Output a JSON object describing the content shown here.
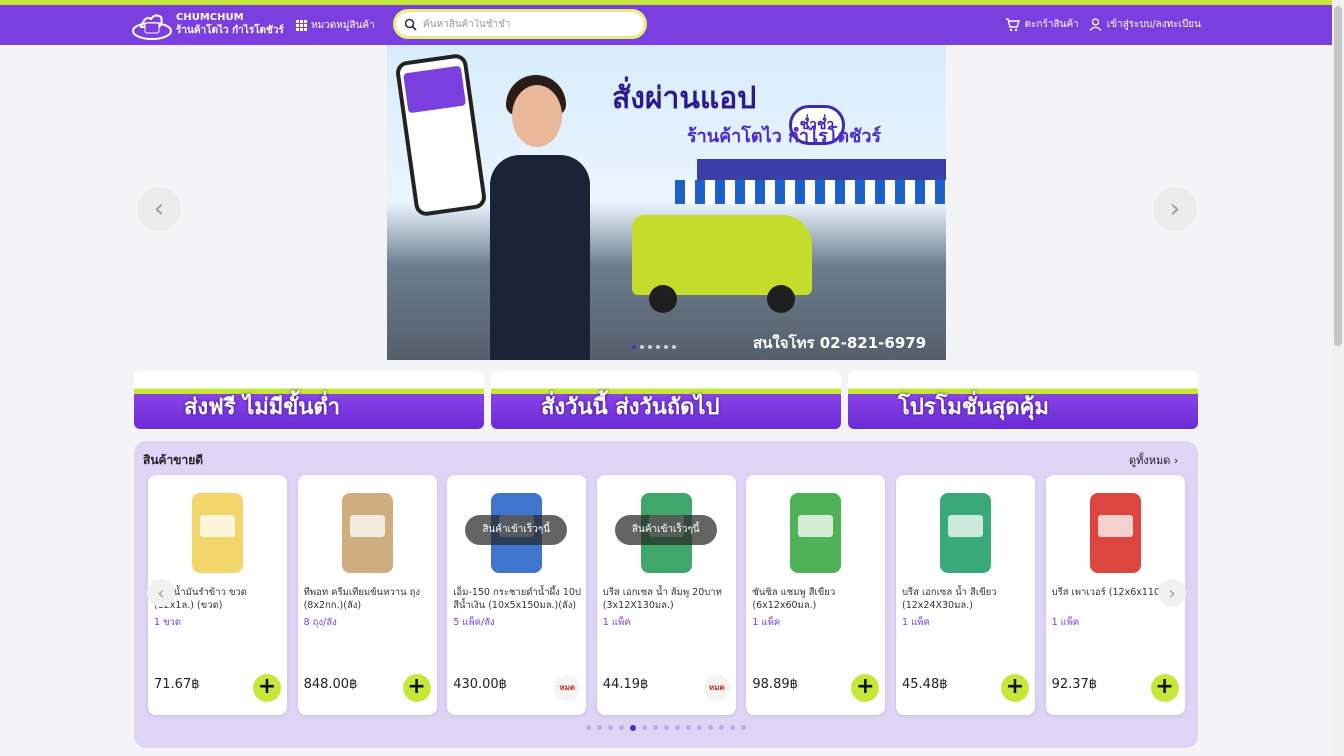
{
  "header": {
    "brand_line1": "CHUMCHUM",
    "brand_line2": "ร้านค้าโตไว กำไรโตชัวร์",
    "categories_label": "หมวดหมู่สินค้า",
    "search_placeholder": "ค้นหาสินค้าในช่ำช่ำ",
    "cart_label": "ตะกร้าสินค้า",
    "login_label": "เข้าสู่ระบบ/ลงทะเบียน"
  },
  "banner": {
    "headline": "สั่งผ่านแอป",
    "logo_text": "ช่ำช่ำ",
    "subline": "ร้านค้าโตไว กำไรโตชัวร์",
    "contact": "สนใจโทร 02-821-6979"
  },
  "promos": [
    {
      "label": "ส่งฟรี ไม่มีขั้นต่ำ"
    },
    {
      "label": "สั่งวันนี้ ส่งวันถัดไป"
    },
    {
      "label": "โปรโมชั่นสุดคุ้ม"
    }
  ],
  "bestsellers": {
    "title": "สินค้าขายดี",
    "see_all": "ดูทั้งหมด",
    "products": [
      {
        "name": "คิงก์ น้ำมันรำข้าว ขวด (12x1ล.) (ขวด)",
        "unit": "1 ขวด",
        "price": "71.67฿",
        "overlay": "",
        "soldout": false,
        "color": "#f1d25c"
      },
      {
        "name": "ทีพอท ครีมเทียมข้นหวาน ถุง (8x2กก.)(ลัง)",
        "unit": "8 ถุง/ลัง",
        "price": "848.00฿",
        "overlay": "",
        "soldout": false,
        "color": "#c9a571"
      },
      {
        "name": "เอ็ม-150 กระชายดำน้ำผึ้ง 10ป สีน้ำเงิน (10x5x150มล.)(ลัง)",
        "unit": "5 แพ็ค/ลัง",
        "price": "430.00฿",
        "overlay": "สินค้าเข้าเร็วๆนี้",
        "soldout": true,
        "color": "#2a66c7"
      },
      {
        "name": "บรีส เอกเซล น้ำ ส้มพู 20บาท (3x12X130มล.)",
        "unit": "1 แพ็ค",
        "price": "44.19฿",
        "overlay": "สินค้าเข้าเร็วๆนี้",
        "soldout": true,
        "color": "#2a9d5a"
      },
      {
        "name": "ซันซิล แชมพู สีเขียว (6x12x60มล.)",
        "unit": "1 แพ็ค",
        "price": "98.89฿",
        "overlay": "",
        "soldout": false,
        "color": "#3daa45"
      },
      {
        "name": "บรีส เอกเซล น้ำ สีเขียว (12x24X30มล.)",
        "unit": "1 แพ็ค",
        "price": "45.48฿",
        "overlay": "",
        "soldout": false,
        "color": "#24a06a"
      },
      {
        "name": "บรีส เพาเวอร์ (12x6x110ก.)",
        "unit": "1 แพ็ค",
        "price": "92.37฿",
        "overlay": "",
        "soldout": false,
        "color": "#d8322a"
      }
    ],
    "soldout_label": "หมด"
  }
}
